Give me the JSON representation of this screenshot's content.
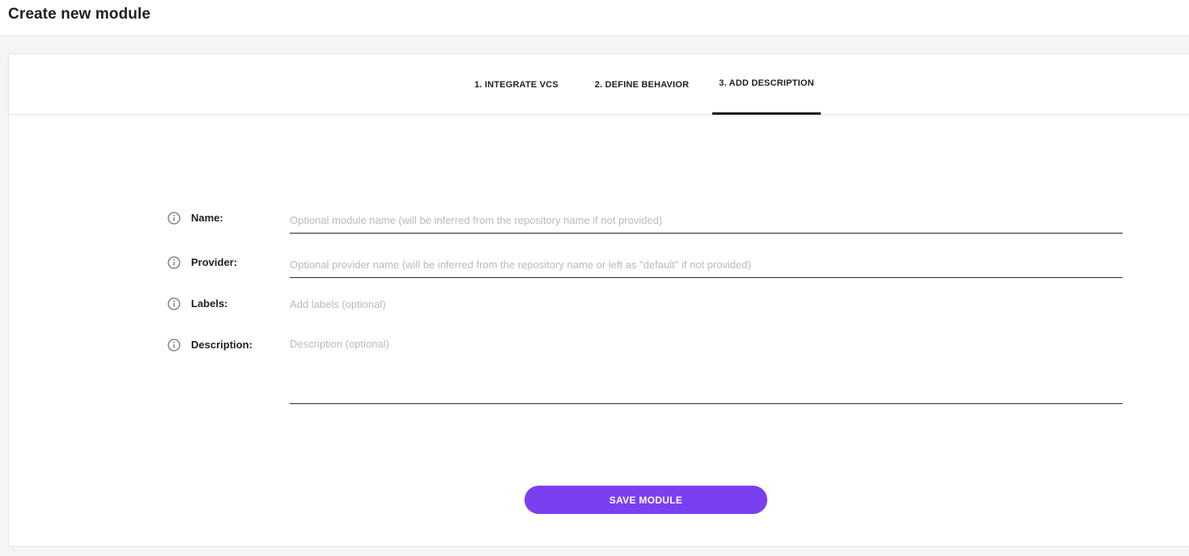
{
  "page": {
    "title": "Create new module"
  },
  "steps": [
    {
      "label": "1. INTEGRATE VCS",
      "active": false
    },
    {
      "label": "2. DEFINE BEHAVIOR",
      "active": false
    },
    {
      "label": "3. ADD DESCRIPTION",
      "active": true
    }
  ],
  "form": {
    "name": {
      "label": "Name:",
      "placeholder": "Optional module name (will be inferred from the repository name if not provided)",
      "value": ""
    },
    "provider": {
      "label": "Provider:",
      "placeholder": "Optional provider name (will be inferred from the repository name or left as \"default\" if not provided)",
      "value": ""
    },
    "labels": {
      "label": "Labels:",
      "placeholder": "Add labels (optional)",
      "value": ""
    },
    "description": {
      "label": "Description:",
      "placeholder": "Description (optional)",
      "value": ""
    }
  },
  "actions": {
    "save_label": "SAVE MODULE"
  },
  "icons": {
    "field_info": "info-icon"
  },
  "colors": {
    "accent": "#7b3ff2",
    "text": "#1e1f26",
    "placeholder": "#b8bac2",
    "border": "#e6e7eb"
  }
}
